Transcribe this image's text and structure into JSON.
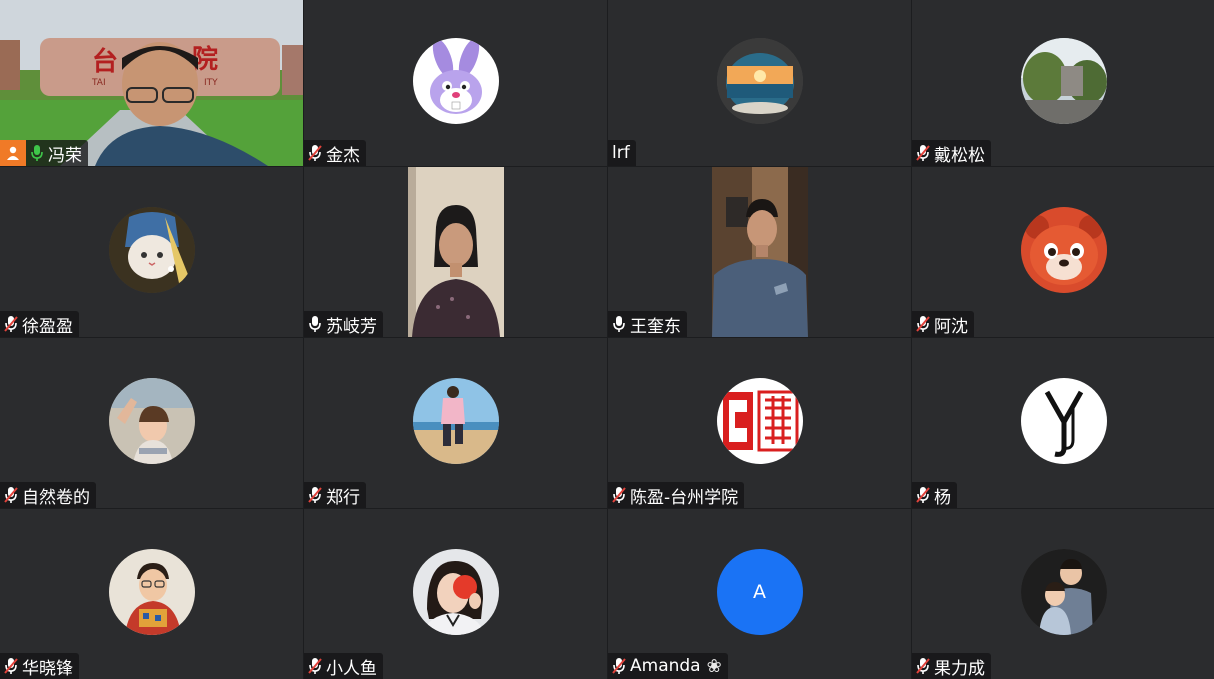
{
  "meeting": {
    "participants": [
      {
        "name": "冯荣",
        "mic": "on",
        "host": true,
        "video": true
      },
      {
        "name": "金杰",
        "mic": "muted",
        "avatar": "cartoon-rabbit"
      },
      {
        "name": "lrf",
        "mic": "none",
        "avatar": "sunset-bowl-photo"
      },
      {
        "name": "戴松松",
        "mic": "muted",
        "avatar": "tree-street-photo"
      },
      {
        "name": "徐盈盈",
        "mic": "muted",
        "avatar": "cat-with-pearl-earring"
      },
      {
        "name": "苏岐芳",
        "mic": "on",
        "video": true
      },
      {
        "name": "王奎东",
        "mic": "on",
        "video": true
      },
      {
        "name": "阿沈",
        "mic": "muted",
        "avatar": "red-panda-cartoon"
      },
      {
        "name": "自然卷的",
        "mic": "muted",
        "avatar": "child-photo"
      },
      {
        "name": "郑行",
        "mic": "muted",
        "avatar": "beach-child-photo"
      },
      {
        "name": "陈盈-台州学院",
        "mic": "muted",
        "avatar": "red-seal"
      },
      {
        "name": "杨",
        "mic": "muted",
        "avatar": "yj-monogram"
      },
      {
        "name": "华晓锋",
        "mic": "muted",
        "avatar": "boy-photo"
      },
      {
        "name": "小人鱼",
        "mic": "muted",
        "avatar": "woman-red-card-photo"
      },
      {
        "name": "Amanda",
        "mic": "muted",
        "avatar_letter": "A",
        "extra_icon": "flower-icon"
      },
      {
        "name": "果力成",
        "mic": "muted",
        "avatar": "two-kids-photo"
      }
    ]
  },
  "colors": {
    "tile_bg": "#2b2c2e",
    "grid_bg": "#1c1d1f",
    "host_badge": "#f07a27",
    "mic_on": "#3fc64a",
    "mic_muted": "#e2433c",
    "letter_avatar": "#1a73f5"
  }
}
